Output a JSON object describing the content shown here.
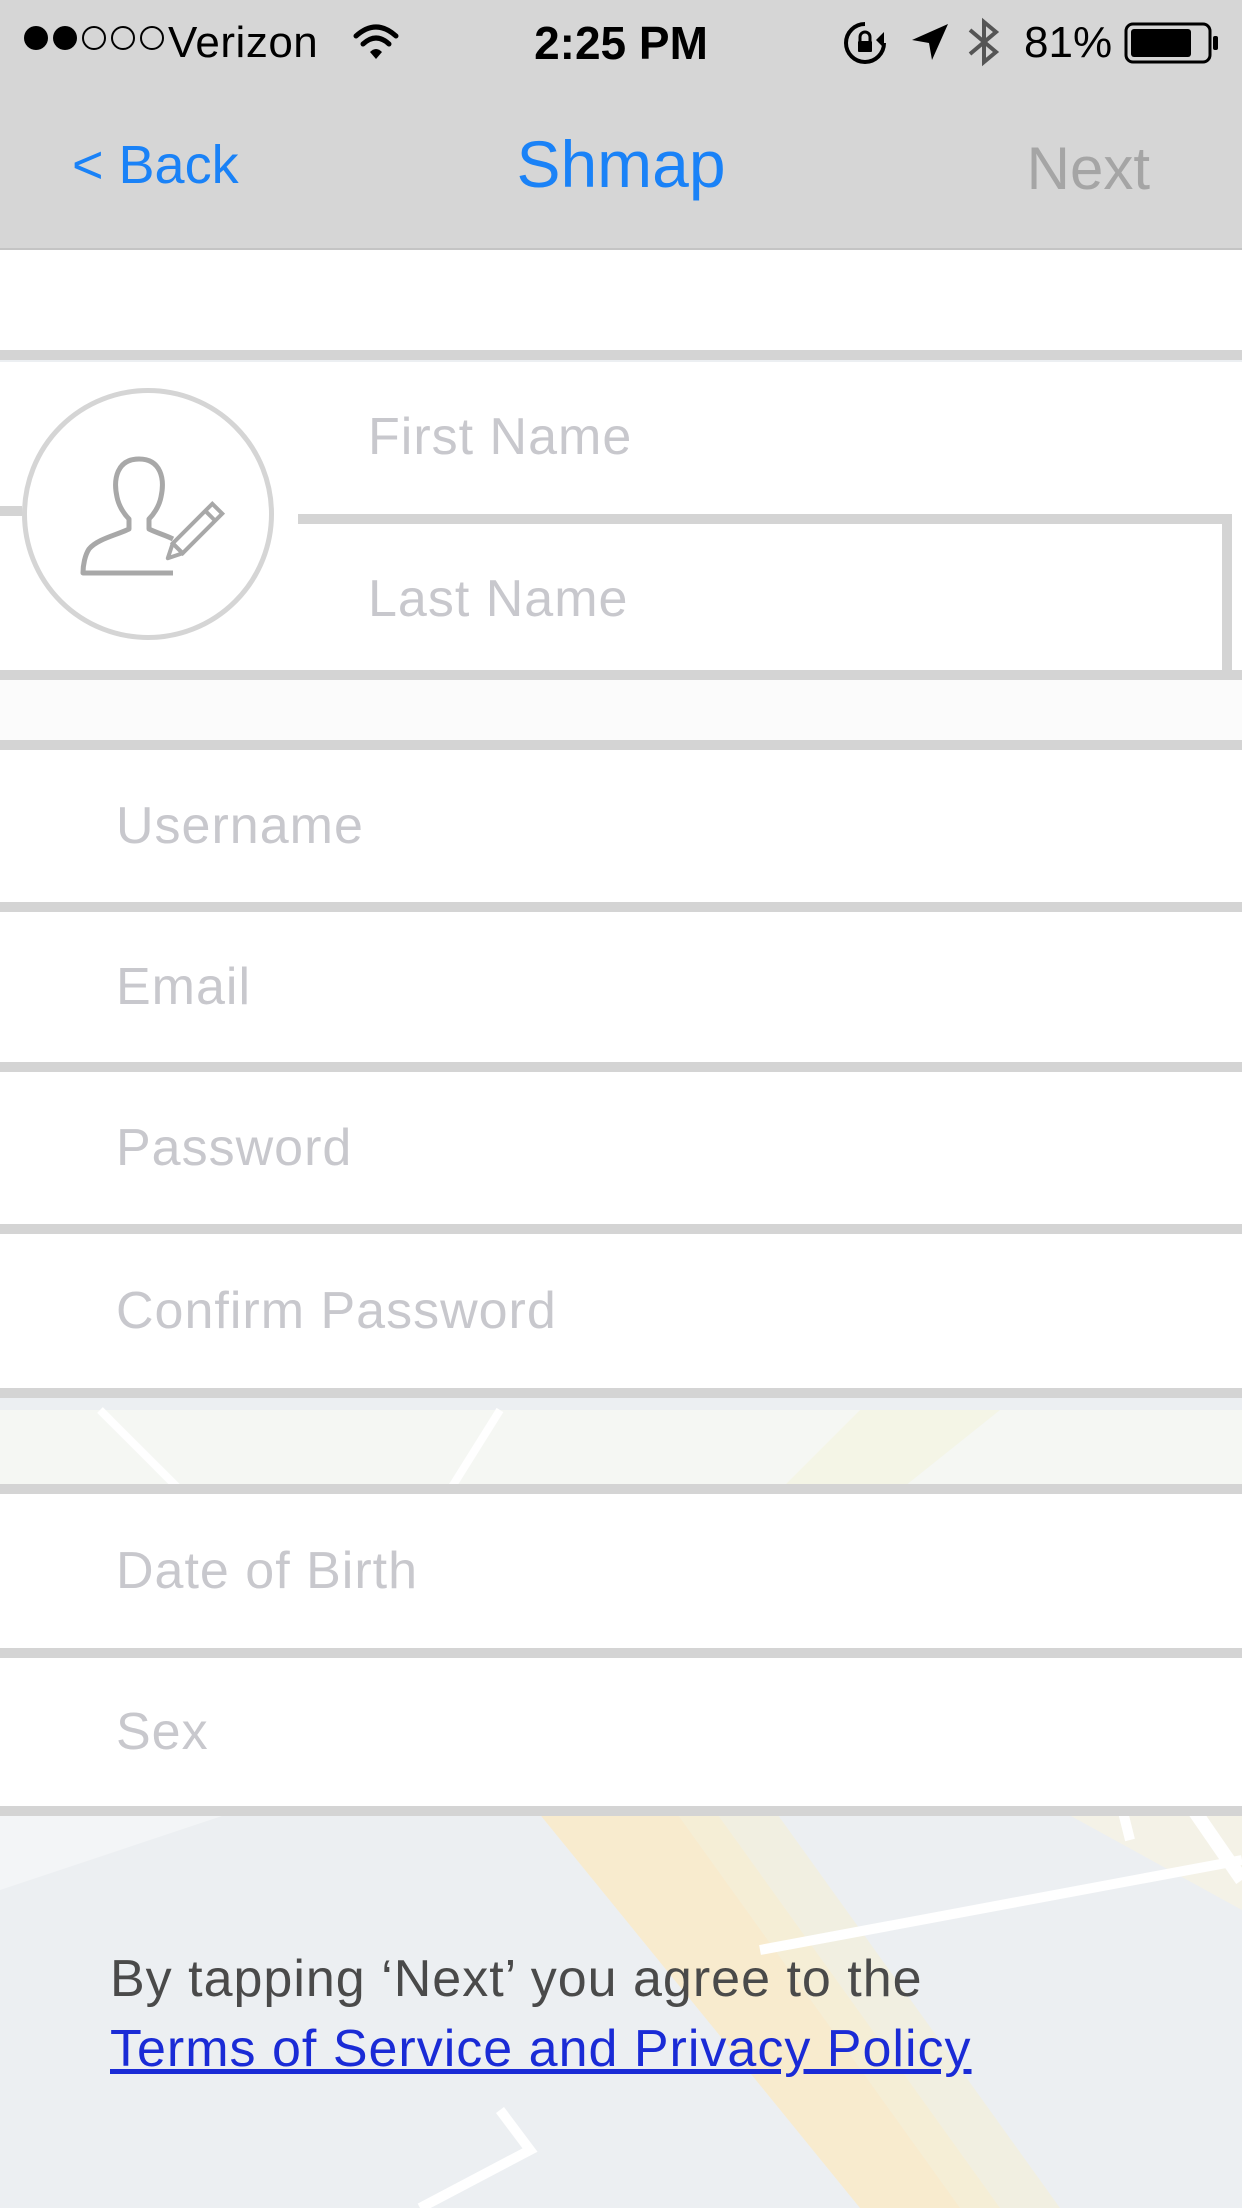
{
  "status_bar": {
    "signal_filled": 2,
    "signal_total": 5,
    "carrier": "Verizon",
    "time": "2:25 PM",
    "battery_percent": "81%",
    "battery_level": 0.81,
    "icons": [
      "wifi-icon",
      "rotation-lock-icon",
      "location-arrow-icon",
      "bluetooth-icon",
      "battery-icon"
    ]
  },
  "nav": {
    "back_label": "< Back",
    "title": "Shmap",
    "next_label": "Next",
    "accent_color": "#1a82f7",
    "disabled_color": "#a5a5a5"
  },
  "profile": {
    "avatar_icon": "person-edit-icon",
    "first_name_placeholder": "First Name",
    "last_name_placeholder": "Last Name"
  },
  "account": {
    "username_placeholder": "Username",
    "email_placeholder": "Email",
    "password_placeholder": "Password",
    "confirm_password_placeholder": "Confirm Password"
  },
  "personal": {
    "dob_placeholder": "Date of Birth",
    "sex_placeholder": "Sex"
  },
  "footer": {
    "agreement_text": "By tapping ‘Next’ you agree to the",
    "terms_link": "Terms of Service and Privacy Policy"
  }
}
